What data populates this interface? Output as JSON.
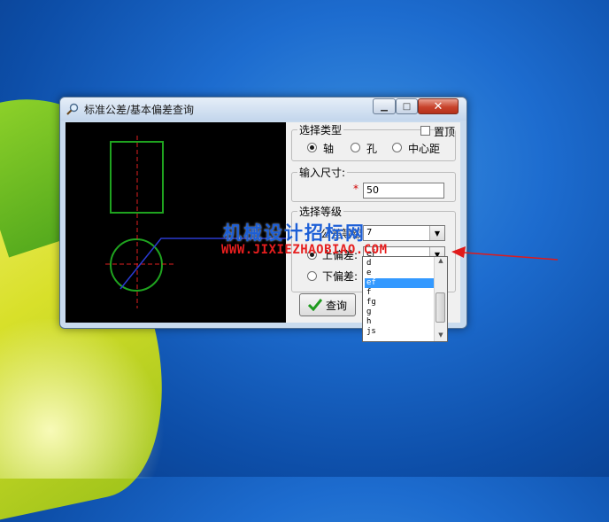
{
  "window": {
    "title": "标准公差/基本偏差查询"
  },
  "type_group": {
    "legend": "选择类型",
    "pin_top_label": "置顶",
    "options": [
      "轴",
      "孔",
      "中心距"
    ],
    "selected": "轴"
  },
  "size_group": {
    "legend": "输入尺寸:",
    "required_mark": "*",
    "value": "50"
  },
  "grade_group": {
    "legend": "选择等级",
    "grade_label": "公差等级:",
    "grade_value": "7",
    "upper_label": "上偏差:",
    "upper_value": "ef",
    "lower_label": "下偏差:"
  },
  "query_button": {
    "label": "查询"
  },
  "dropdown": {
    "items": [
      "d",
      "e",
      "ef",
      "f",
      "fg",
      "g",
      "h",
      "js"
    ],
    "selected": "ef"
  },
  "watermark": {
    "line1": "机械设计招标网",
    "line2": "WWW.JIXIEZHAOBIAO.COM"
  },
  "colors": {
    "canvas_bg": "#000000",
    "shape_stroke": "#1fa31f",
    "center_line": "#e02020",
    "leader_line": "#2a3ad0",
    "selection": "#3399ff"
  }
}
